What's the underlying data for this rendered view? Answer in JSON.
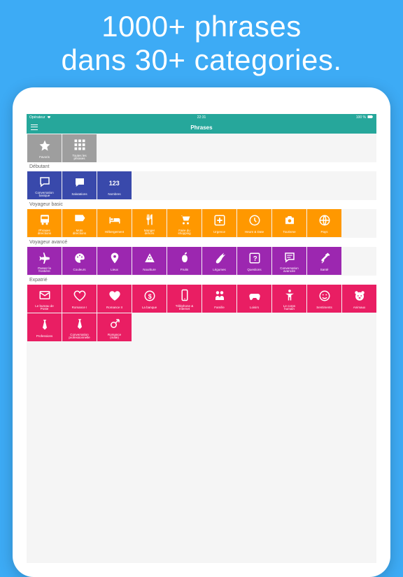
{
  "hero": {
    "line1": "1000+ phrases",
    "line2": "dans 30+ categories."
  },
  "statusBar": {
    "carrier": "Opérateur",
    "time": "22:31",
    "battery": "100 %"
  },
  "navBar": {
    "title": "Phrases"
  },
  "topTiles": [
    {
      "icon": "star",
      "label": "Favoris"
    },
    {
      "icon": "grid",
      "label": "Toutes les\nphrases"
    }
  ],
  "sections": [
    {
      "title": "Débutant",
      "color": "c-blue",
      "tiles": [
        {
          "icon": "speech",
          "label": "Conversation\nbasique"
        },
        {
          "icon": "speech-fill",
          "label": "Salutations"
        },
        {
          "icon": "numbers",
          "label": "Nombres"
        }
      ]
    },
    {
      "title": "Voyageur basic",
      "color": "c-orange",
      "tiles": [
        {
          "icon": "bus",
          "label": "Phrases\ndirections"
        },
        {
          "icon": "arrow-sign",
          "label": "Mots\ndirections"
        },
        {
          "icon": "bed",
          "label": "Hébergement"
        },
        {
          "icon": "food",
          "label": "Manger\ndehors"
        },
        {
          "icon": "cart",
          "label": "Faire du\nshopping"
        },
        {
          "icon": "plus",
          "label": "Urgence"
        },
        {
          "icon": "clock",
          "label": "Heure & Date"
        },
        {
          "icon": "camera",
          "label": "Tourisme"
        },
        {
          "icon": "globe",
          "label": "Pays"
        }
      ]
    },
    {
      "title": "Voyageur avancé",
      "color": "c-purple",
      "tiles": [
        {
          "icon": "plane",
          "label": "Passer la\nfrontière"
        },
        {
          "icon": "palette",
          "label": "Couleurs"
        },
        {
          "icon": "pin",
          "label": "Lieux"
        },
        {
          "icon": "pizza",
          "label": "Nouriture"
        },
        {
          "icon": "apple",
          "label": "Fruits"
        },
        {
          "icon": "carrot",
          "label": "Légumes"
        },
        {
          "icon": "question",
          "label": "Questions"
        },
        {
          "icon": "chat-lines",
          "label": "Conversation\navancée"
        },
        {
          "icon": "syringe",
          "label": "Santé"
        }
      ]
    },
    {
      "title": "Expatrié",
      "color": "c-pink",
      "tiles": [
        {
          "icon": "mail",
          "label": "Le bureau de\nPoste"
        },
        {
          "icon": "heart-o",
          "label": "Romance I"
        },
        {
          "icon": "heart",
          "label": "Romance II"
        },
        {
          "icon": "dollar",
          "label": "La banque"
        },
        {
          "icon": "phone",
          "label": "Téléphone &\nInternet"
        },
        {
          "icon": "family",
          "label": "Famille"
        },
        {
          "icon": "gamepad",
          "label": "Loisirs"
        },
        {
          "icon": "body",
          "label": "Le corps\nhumain"
        },
        {
          "icon": "smile",
          "label": "Sentiments"
        },
        {
          "icon": "bear",
          "label": "Animaux"
        },
        {
          "icon": "tie",
          "label": "Professions"
        },
        {
          "icon": "tie",
          "label": "Conversation\nprofessionnelle"
        },
        {
          "icon": "gender",
          "label": "Romance\n(mâle)"
        }
      ]
    }
  ]
}
